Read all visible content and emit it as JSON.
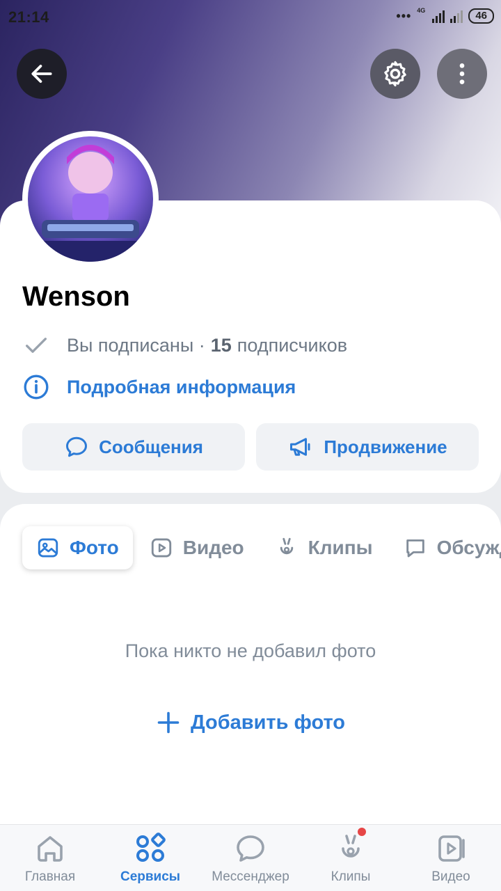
{
  "status_bar": {
    "time": "21:14",
    "dots": "•••",
    "network": "4G",
    "battery": "46"
  },
  "header": {
    "back_icon": "arrow-left-icon",
    "settings_icon": "gear-icon",
    "more_icon": "more-vertical-icon"
  },
  "profile": {
    "name": "Wenson",
    "subscribed_text": "Вы подписаны ·",
    "subscribers_count": "15",
    "subscribers_label": "подписчиков",
    "details_link": "Подробная информация"
  },
  "actions": {
    "messages": "Сообщения",
    "promotion": "Продвижение"
  },
  "tabs": [
    {
      "label": "Фото",
      "icon": "image-icon",
      "active": true
    },
    {
      "label": "Видео",
      "icon": "video-icon"
    },
    {
      "label": "Клипы",
      "icon": "clips-icon"
    },
    {
      "label": "Обсуждения",
      "icon": "discussion-icon"
    }
  ],
  "empty_state": {
    "text": "Пока никто не добавил фото",
    "add_button": "Добавить фото"
  },
  "bottom_nav": [
    {
      "label": "Главная",
      "icon": "home-icon"
    },
    {
      "label": "Сервисы",
      "icon": "services-icon",
      "active": true
    },
    {
      "label": "Мессенджер",
      "icon": "chat-icon"
    },
    {
      "label": "Клипы",
      "icon": "clips-icon",
      "badge": true
    },
    {
      "label": "Видео",
      "icon": "video-icon"
    }
  ],
  "colors": {
    "accent": "#2c7bd6",
    "secondary_text": "#818c99",
    "badge": "#e64646"
  }
}
